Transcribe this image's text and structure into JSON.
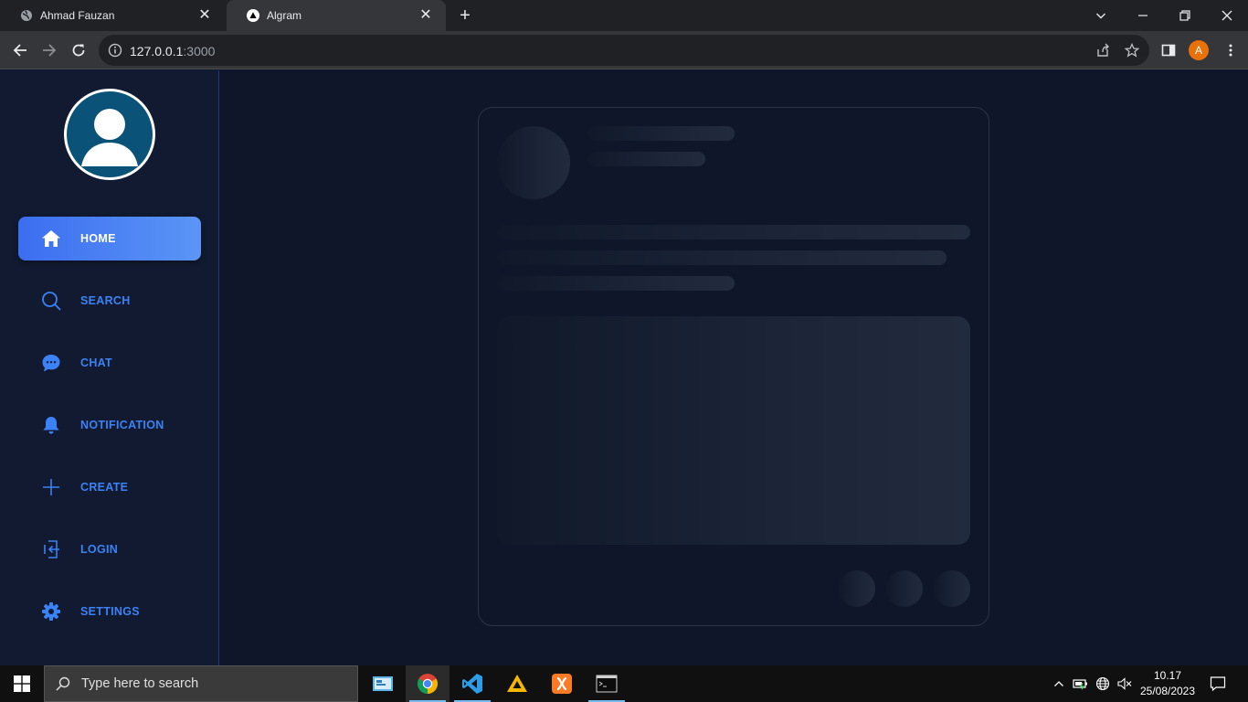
{
  "browser": {
    "tabs": [
      {
        "title": "Ahmad Fauzan"
      },
      {
        "title": "Algram"
      }
    ],
    "url": {
      "host": "127.0.0.1",
      "port": ":3000"
    },
    "profile_initial": "A"
  },
  "sidebar": {
    "items": [
      {
        "label": "HOME",
        "icon": "home-icon",
        "active": true
      },
      {
        "label": "SEARCH",
        "icon": "search-icon"
      },
      {
        "label": "CHAT",
        "icon": "chat-icon"
      },
      {
        "label": "NOTIFICATION",
        "icon": "bell-icon"
      },
      {
        "label": "CREATE",
        "icon": "plus-icon"
      },
      {
        "label": "LOGIN",
        "icon": "login-icon"
      },
      {
        "label": "SETTINGS",
        "icon": "gear-icon"
      }
    ]
  },
  "colors": {
    "accent": "#3b82f6",
    "background": "#0f1629",
    "sidebar": "#111a30",
    "avatar_bg": "#0b5279"
  },
  "taskbar": {
    "search_placeholder": "Type here to search",
    "time": "10.17",
    "date": "25/08/2023",
    "apps": [
      "file-explorer-icon",
      "chrome-icon",
      "vscode-icon",
      "app-icon",
      "xampp-icon",
      "terminal-icon"
    ]
  }
}
